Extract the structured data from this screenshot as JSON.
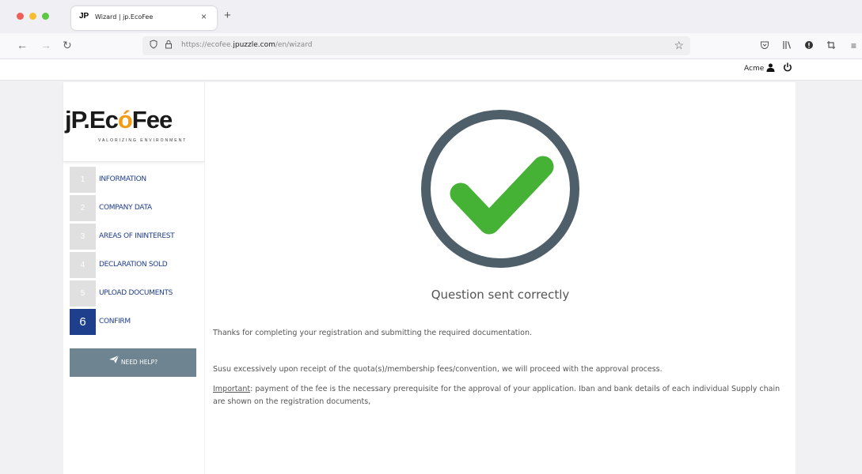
{
  "browser": {
    "tab_title": "Wizard | jp.EcoFee",
    "tab_favicon": "JP",
    "close_glyph": "×",
    "newtab_glyph": "+",
    "url_prefix": "https://ecofee.",
    "url_domain": "jpuzzle.com",
    "url_path": "/en/wizard"
  },
  "header": {
    "user": "Acme"
  },
  "sidebar": {
    "logo_main_a": "jP.Ec",
    "logo_main_o": "ó",
    "logo_main_b": "Fee",
    "logo_tagline": "VALORIZING ENVIRONMENT",
    "steps": [
      {
        "num": "1",
        "label": "INFORMATION"
      },
      {
        "num": "2",
        "label": "COMPANY DATA"
      },
      {
        "num": "3",
        "label": "AREAS OF ININTEREST"
      },
      {
        "num": "4",
        "label": "DECLARATION SOLD"
      },
      {
        "num": "5",
        "label": "UPLOAD DOCUMENTS"
      },
      {
        "num": "6",
        "label": "CONFIRM"
      }
    ],
    "help_label": "NEED HELP?"
  },
  "main": {
    "status": "Question sent correctly",
    "thanks": "Thanks for completing your registration and submitting the required documentation.",
    "approval": "Susu excessively upon receipt of the quota(s)/membership fees/convention, we will proceed with the approval process.",
    "important_label": "Important",
    "important_text": ": payment of the fee is the necessary prerequisite for the approval of your application. Iban and bank details of each individual Supply chain are shown on the registration documents,"
  },
  "colors": {
    "step_active": "#1d3f8c",
    "step_inactive": "#e0e0e0",
    "check_ring": "#4f5f6a",
    "check_mark": "#45b236",
    "help_button": "#6e8591"
  },
  "icons": [
    "back-icon",
    "forward-icon",
    "reload-icon",
    "shield-icon",
    "lock-icon",
    "star-icon",
    "pocket-icon",
    "library-icon",
    "extension-icon",
    "screenshot-icon",
    "menu-icon",
    "user-icon",
    "power-icon",
    "paper-plane-icon",
    "check-icon"
  ]
}
